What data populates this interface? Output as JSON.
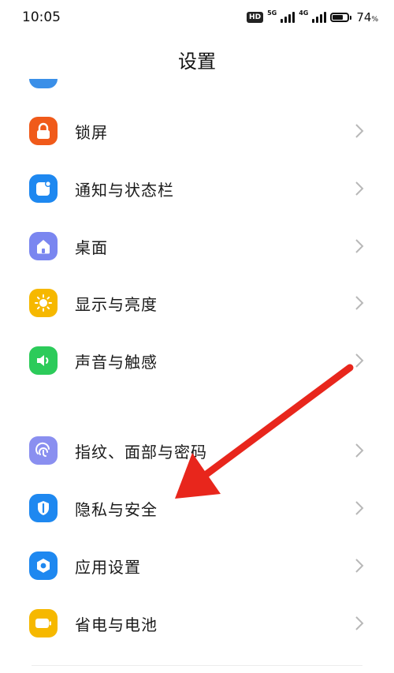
{
  "status_bar": {
    "time": "10:05",
    "hd_badge": "HD",
    "network_1": "5G",
    "network_2": "4G",
    "battery_percent": "74",
    "battery_unit": "%",
    "battery_level": 0.74
  },
  "header": {
    "title": "设置"
  },
  "group1": [
    {
      "label": "锁屏",
      "icon": "lock-icon",
      "color": "#f05a1a"
    },
    {
      "label": "通知与状态栏",
      "icon": "notification-icon",
      "color": "#1e88f0"
    },
    {
      "label": "桌面",
      "icon": "home-icon",
      "color": "#7a86f0"
    },
    {
      "label": "显示与亮度",
      "icon": "sun-icon",
      "color": "#f6b800"
    },
    {
      "label": "声音与触感",
      "icon": "speaker-icon",
      "color": "#2ccb5a"
    }
  ],
  "group2": [
    {
      "label": "指纹、面部与密码",
      "icon": "fingerprint-icon",
      "color": "#8a8ff0"
    },
    {
      "label": "隐私与安全",
      "icon": "privacy-shield-icon",
      "color": "#1e88f0"
    },
    {
      "label": "应用设置",
      "icon": "app-settings-icon",
      "color": "#1e88f0"
    },
    {
      "label": "省电与电池",
      "icon": "battery-saver-icon",
      "color": "#f6b800"
    }
  ],
  "annotation": {
    "arrow_color": "#e8261c"
  }
}
